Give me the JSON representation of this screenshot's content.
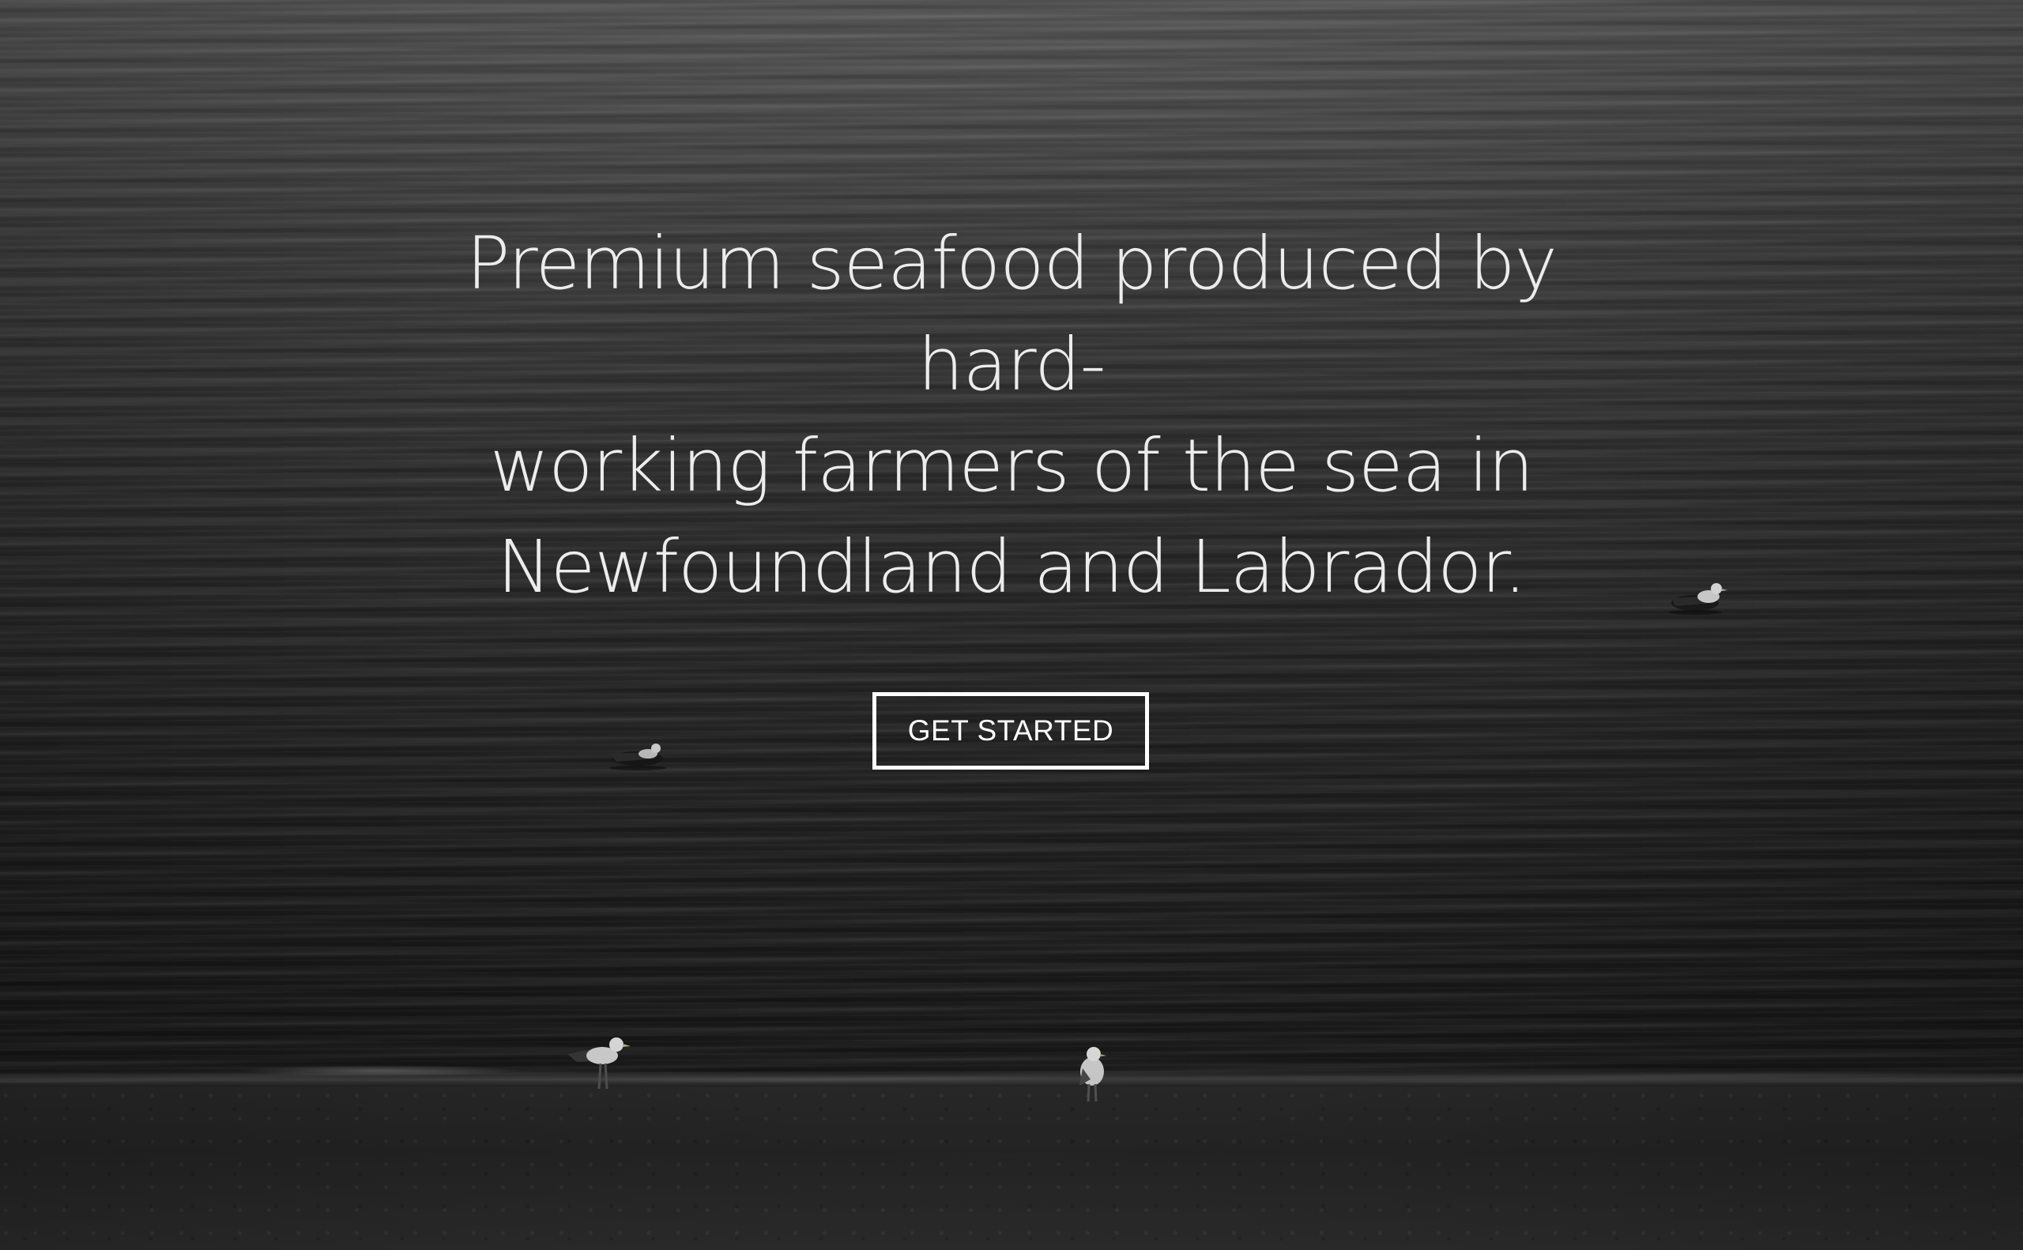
{
  "hero": {
    "headline_lines": [
      "Premium seafood produced by hard-",
      "working farmers of the sea in",
      "Newfoundland and Labrador."
    ],
    "cta_label": "GET STARTED",
    "background_icon": "ocean-with-seagulls-photo"
  },
  "colors": {
    "text": "#ececec",
    "button_border": "#ffffff"
  }
}
